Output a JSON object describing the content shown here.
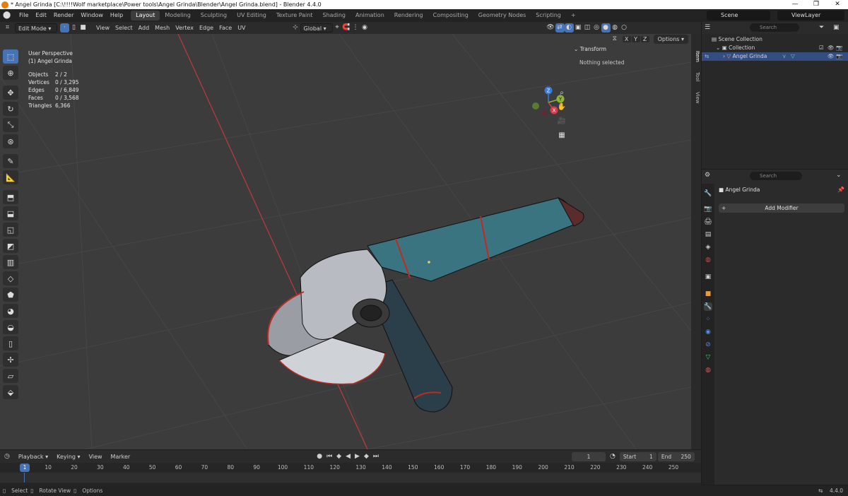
{
  "window": {
    "title": "* Angel Grinda [C:\\!!!!Wolf marketplace\\Power tools\\Angel Grinda\\Blender\\Angel Grinda.blend] - Blender 4.4.0",
    "minimize": "—",
    "maximize": "❐",
    "close": "✕"
  },
  "menu": {
    "items": [
      "File",
      "Edit",
      "Render",
      "Window",
      "Help"
    ],
    "workspaces": [
      "Layout",
      "Modeling",
      "Sculpting",
      "UV Editing",
      "Texture Paint",
      "Shading",
      "Animation",
      "Rendering",
      "Compositing",
      "Geometry Nodes",
      "Scripting"
    ],
    "active_workspace": "Layout",
    "add_tab": "+",
    "scene": "Scene",
    "view_layer": "ViewLayer"
  },
  "viewport_header": {
    "mode": "Edit Mode",
    "menus": [
      "View",
      "Select",
      "Add",
      "Mesh",
      "Vertex",
      "Edge",
      "Face",
      "UV"
    ],
    "orientation": "Global",
    "axes": [
      "X",
      "Y",
      "Z"
    ],
    "options": "Options"
  },
  "overlay": {
    "view_name": "User Perspective",
    "object_name": "(1) Angel Grinda"
  },
  "stats": [
    {
      "label": "Objects",
      "value": "2 / 2"
    },
    {
      "label": "Vertices",
      "value": "0 / 3,295"
    },
    {
      "label": "Edges",
      "value": "0 / 6,849"
    },
    {
      "label": "Faces",
      "value": "0 / 3,568"
    },
    {
      "label": "Triangles",
      "value": "6,366"
    }
  ],
  "gizmo": {
    "x": "X",
    "y": "Y",
    "z": "Z"
  },
  "npanel": {
    "section": "Transform",
    "message": "Nothing selected",
    "tabs": [
      "Item",
      "Tool",
      "View"
    ]
  },
  "outliner": {
    "search_placeholder": "Search",
    "scene_collection": "Scene Collection",
    "collection": "Collection",
    "object": "Angel Grinda"
  },
  "properties": {
    "search_placeholder": "Search",
    "object_name": "Angel Grinda",
    "add_modifier": "Add Modifier"
  },
  "timeline": {
    "menus": [
      "Playback",
      "Keying",
      "View",
      "Marker"
    ],
    "current_frame": "1",
    "start_label": "Start",
    "start": "1",
    "end_label": "End",
    "end": "250",
    "ruler": [
      "1",
      "10",
      "20",
      "30",
      "40",
      "50",
      "60",
      "70",
      "80",
      "90",
      "100",
      "110",
      "120",
      "130",
      "140",
      "150",
      "160",
      "170",
      "180",
      "190",
      "200",
      "210",
      "220",
      "230",
      "240",
      "250"
    ]
  },
  "status": {
    "select": "Select",
    "rotate": "Rotate View",
    "options": "Options",
    "version": "4.4.0"
  },
  "colors": {
    "accent": "#4772b3",
    "mesh_body": "#3a7480",
    "mesh_red": "#c02a22",
    "mesh_gray": "#b8bcc2",
    "viewport_bg": "#3c3c3c"
  }
}
